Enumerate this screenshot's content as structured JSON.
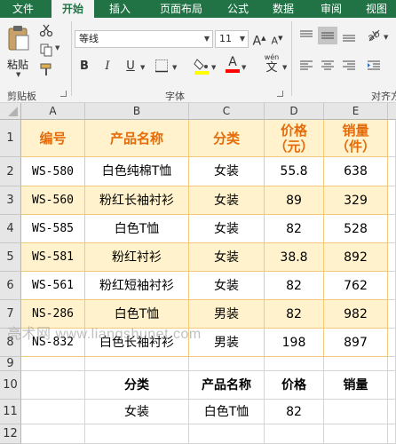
{
  "tabs": [
    "文件",
    "开始",
    "插入",
    "页面布局",
    "公式",
    "数据",
    "审阅",
    "视图"
  ],
  "clipboard": {
    "paste_label": "粘贴",
    "group_label": "剪贴板"
  },
  "font": {
    "name": "等线",
    "size": "11",
    "group_label": "字体",
    "wen_label": "wén",
    "wen_char": "文",
    "bold": "B",
    "italic": "I",
    "underline": "U",
    "grow": "A",
    "shrink": "A",
    "font_color_letter": "A"
  },
  "alignment": {
    "group_label": "对齐方"
  },
  "colors": {
    "tab_bar": "#217346",
    "header_text": "#e46c0a",
    "header_fill": "#fff2cc",
    "stripe_fill": "#fff2cc",
    "highlight_yellow": "#ffff00",
    "font_red": "#ff0000"
  },
  "sheet": {
    "columns": [
      "A",
      "B",
      "C",
      "D",
      "E"
    ],
    "rows": [
      {
        "num": "1",
        "cells": [
          "编号",
          "产品名称",
          "分类",
          "价格\n（元）",
          "销量\n（件）"
        ]
      },
      {
        "num": "2",
        "cells": [
          "WS-580",
          "白色纯棉T恤",
          "女装",
          "55.8",
          "638"
        ]
      },
      {
        "num": "3",
        "cells": [
          "WS-560",
          "粉红长袖衬衫",
          "女装",
          "89",
          "329"
        ]
      },
      {
        "num": "4",
        "cells": [
          "WS-585",
          "白色T恤",
          "女装",
          "82",
          "528"
        ]
      },
      {
        "num": "5",
        "cells": [
          "WS-581",
          "粉红衬衫",
          "女装",
          "38.8",
          "892"
        ]
      },
      {
        "num": "6",
        "cells": [
          "WS-561",
          "粉红短袖衬衫",
          "女装",
          "82",
          "762"
        ]
      },
      {
        "num": "7",
        "cells": [
          "NS-286",
          "白色T恤",
          "男装",
          "82",
          "982"
        ]
      },
      {
        "num": "8",
        "cells": [
          "NS-832",
          "白色长袖衬衫",
          "男装",
          "198",
          "897"
        ]
      },
      {
        "num": "9",
        "cells": [
          "",
          "",
          "",
          "",
          ""
        ]
      },
      {
        "num": "10",
        "cells": [
          "",
          "分类",
          "产品名称",
          "价格",
          "销量"
        ]
      },
      {
        "num": "11",
        "cells": [
          "",
          "女装",
          "白色T恤",
          "82",
          ""
        ]
      },
      {
        "num": "12",
        "cells": [
          "",
          "",
          "",
          "",
          ""
        ]
      }
    ]
  },
  "watermark": "亮术网 www.liangshunet.com"
}
